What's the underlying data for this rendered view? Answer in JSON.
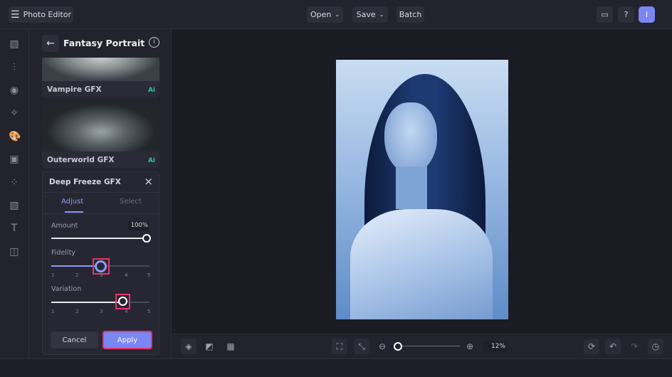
{
  "app": {
    "title": "Photo Editor",
    "menu_icon": "hamburger-icon"
  },
  "topbar": {
    "open": "Open",
    "save": "Save",
    "batch": "Batch",
    "user_initial": "I",
    "accent": "#7b86f5"
  },
  "panel": {
    "title": "Fantasy Portrait",
    "cards": [
      {
        "label": "Vampire GFX",
        "badge": "Ai"
      },
      {
        "label": "Outerworld GFX",
        "badge": "Ai"
      }
    ]
  },
  "effect": {
    "title": "Deep Freeze GFX",
    "tabs": [
      "Adjust",
      "Select"
    ],
    "active_tab": "Adjust",
    "amount": {
      "label": "Amount",
      "value": "100%",
      "percent": 100
    },
    "fidelity": {
      "label": "Fidelity",
      "value": 3,
      "ticks": [
        "1",
        "2",
        "3",
        "4",
        "5"
      ]
    },
    "variation": {
      "label": "Variation",
      "value": 4,
      "ticks": [
        "1",
        "2",
        "3",
        "4",
        "5"
      ]
    },
    "cancel": "Cancel",
    "apply": "Apply",
    "highlight": "#e8336b"
  },
  "bottom": {
    "zoom": "12%",
    "zoom_fraction": 0.0
  }
}
